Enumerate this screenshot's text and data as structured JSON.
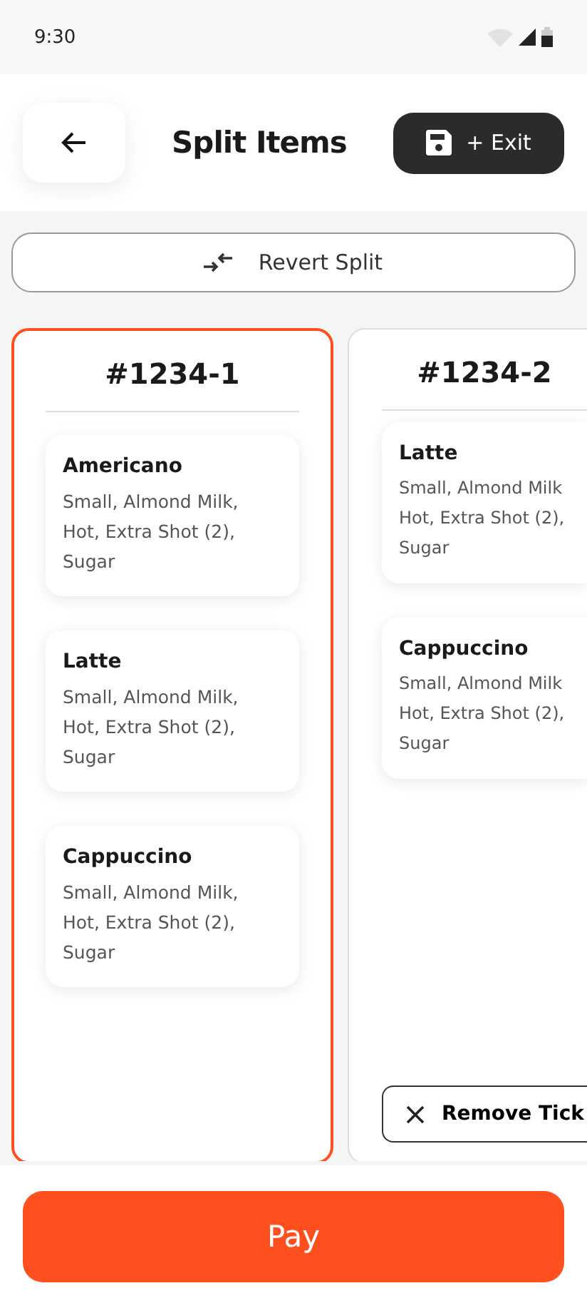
{
  "status_bar": {
    "time": "9:30"
  },
  "header": {
    "title": "Split Items",
    "save_button": "+ Exit"
  },
  "revert_button": "Revert Split",
  "tickets": [
    {
      "title": "#1234-1",
      "selected": true,
      "items": [
        {
          "name": "Americano",
          "details": [
            "Small, Almond Milk,",
            "Hot, Extra Shot (2),",
            "Sugar"
          ]
        },
        {
          "name": "Latte",
          "details": [
            "Small, Almond Milk,",
            "Hot, Extra Shot (2),",
            "Sugar"
          ]
        },
        {
          "name": "Cappuccino",
          "details": [
            "Small, Almond Milk,",
            "Hot, Extra Shot (2),",
            "Sugar"
          ]
        }
      ]
    },
    {
      "title": "#1234-2",
      "selected": false,
      "remove_button": "Remove Tick",
      "items": [
        {
          "name": "Latte",
          "details": [
            "Small, Almond Milk",
            "Hot, Extra Shot (2),",
            "Sugar"
          ]
        },
        {
          "name": "Cappuccino",
          "details": [
            "Small, Almond Milk",
            "Hot, Extra Shot (2),",
            "Sugar"
          ]
        }
      ]
    }
  ],
  "pay_button": "Pay"
}
